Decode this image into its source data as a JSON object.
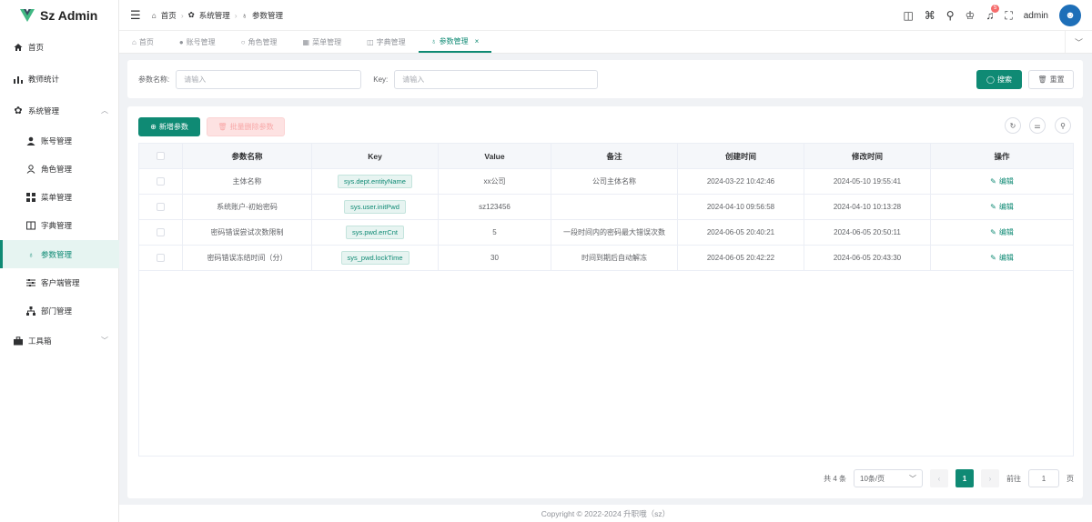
{
  "app": {
    "title": "Sz Admin"
  },
  "sidebar": {
    "items": [
      {
        "label": "首页",
        "icon": "home-icon"
      },
      {
        "label": "教师统计",
        "icon": "chart-icon"
      },
      {
        "label": "系统管理",
        "icon": "gear-icon"
      },
      {
        "label": "账号管理",
        "icon": "user-icon"
      },
      {
        "label": "角色管理",
        "icon": "user-outline-icon"
      },
      {
        "label": "菜单管理",
        "icon": "grid-icon"
      },
      {
        "label": "字典管理",
        "icon": "book-icon"
      },
      {
        "label": "参数管理",
        "icon": "param-icon"
      },
      {
        "label": "客户端管理",
        "icon": "sliders-icon"
      },
      {
        "label": "部门管理",
        "icon": "org-icon"
      },
      {
        "label": "工具箱",
        "icon": "toolbox-icon"
      }
    ],
    "active": "参数管理"
  },
  "header": {
    "breadcrumb": [
      "首页",
      "系统管理",
      "参数管理"
    ],
    "notifications": "5",
    "username": "admin"
  },
  "tabs": [
    "首页",
    "账号管理",
    "角色管理",
    "菜单管理",
    "字典管理",
    "参数管理"
  ],
  "search": {
    "name_label": "参数名称:",
    "name_placeholder": "请输入",
    "key_label": "Key:",
    "key_placeholder": "请输入",
    "search_btn": "搜索",
    "reset_btn": "重置"
  },
  "toolbar": {
    "add_btn": "新增参数",
    "batch_delete_btn": "批量删除参数"
  },
  "table": {
    "columns": [
      "参数名称",
      "Key",
      "Value",
      "备注",
      "创建时间",
      "修改时间",
      "操作"
    ],
    "rows": [
      {
        "name": "主体名称",
        "key": "sys.dept.entityName",
        "value": "xx公司",
        "remark": "公司主体名称",
        "created": "2024-03-22 10:42:46",
        "modified": "2024-05-10 19:55:41",
        "action": "编辑"
      },
      {
        "name": "系统账户-初始密码",
        "key": "sys.user.initPwd",
        "value": "sz123456",
        "remark": "",
        "created": "2024-04-10 09:56:58",
        "modified": "2024-04-10 10:13:28",
        "action": "编辑"
      },
      {
        "name": "密码错误尝试次数限制",
        "key": "sys.pwd.errCnt",
        "value": "5",
        "remark": "一段时间内的密码最大错误次数",
        "created": "2024-06-05 20:40:21",
        "modified": "2024-06-05 20:50:11",
        "action": "编辑"
      },
      {
        "name": "密码错误冻结时间（分）",
        "key": "sys_pwd.lockTime",
        "value": "30",
        "remark": "时间到期后自动解冻",
        "created": "2024-06-05 20:42:22",
        "modified": "2024-06-05 20:43:30",
        "action": "编辑"
      }
    ]
  },
  "pagination": {
    "total": "共 4 条",
    "page_size": "10条/页",
    "current": "1",
    "goto_label": "前往",
    "goto_value": "1",
    "page_unit": "页"
  },
  "footer": {
    "text": "Copyright © 2022-2024 升职哦（sz）"
  },
  "colors": {
    "primary": "#0f8a74",
    "danger": "#f56c6c"
  }
}
